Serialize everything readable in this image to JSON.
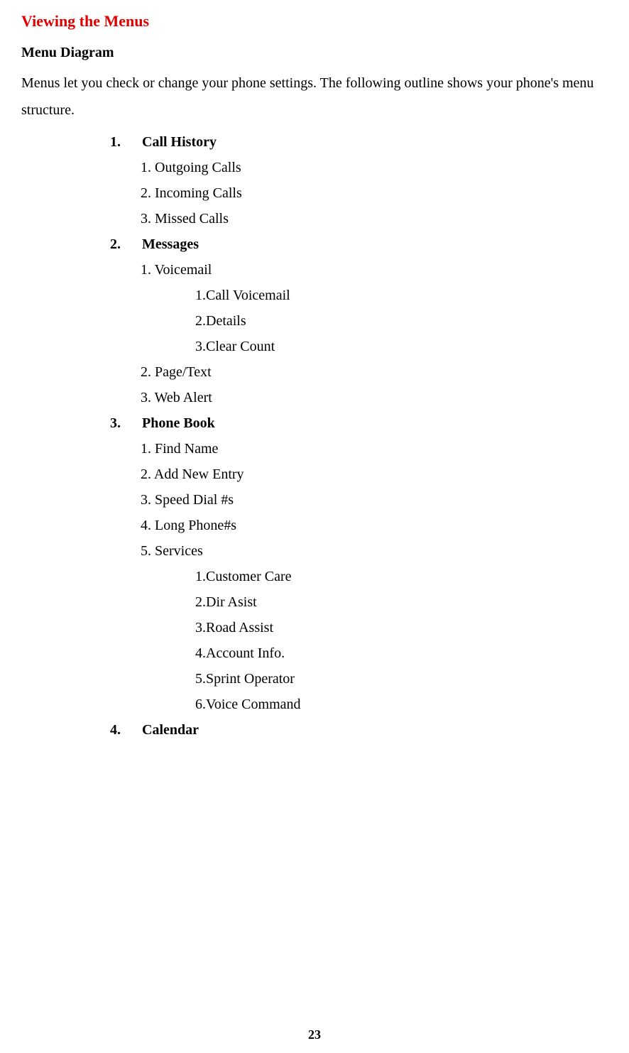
{
  "title": "Viewing the Menus",
  "subtitle": "Menu Diagram",
  "intro": "Menus let you check or change your phone settings. The following outline shows your phone's menu structure.",
  "sections": [
    {
      "number": "1.",
      "title": "Call History",
      "items": [
        "1. Outgoing Calls",
        "2. Incoming Calls",
        "3. Missed Calls"
      ],
      "subitems": []
    },
    {
      "number": "2.",
      "title": "Messages",
      "items": [
        "1. Voicemail"
      ],
      "subitems_1": [
        "1.Call Voicemail",
        "2.Details",
        "3.Clear Count"
      ],
      "items_after": [
        "2. Page/Text",
        "3. Web Alert"
      ]
    },
    {
      "number": "3.",
      "title": "Phone Book",
      "items": [
        "1. Find Name",
        "2. Add New Entry",
        "3. Speed Dial #s",
        "4. Long Phone#s",
        "5. Services"
      ],
      "subitems_5": [
        "1.Customer Care",
        "2.Dir Asist",
        "3.Road Assist",
        "4.Account Info.",
        "5.Sprint Operator",
        "6.Voice Command"
      ]
    },
    {
      "number": "4.",
      "title": "Calendar",
      "items": []
    }
  ],
  "page_number": "23"
}
